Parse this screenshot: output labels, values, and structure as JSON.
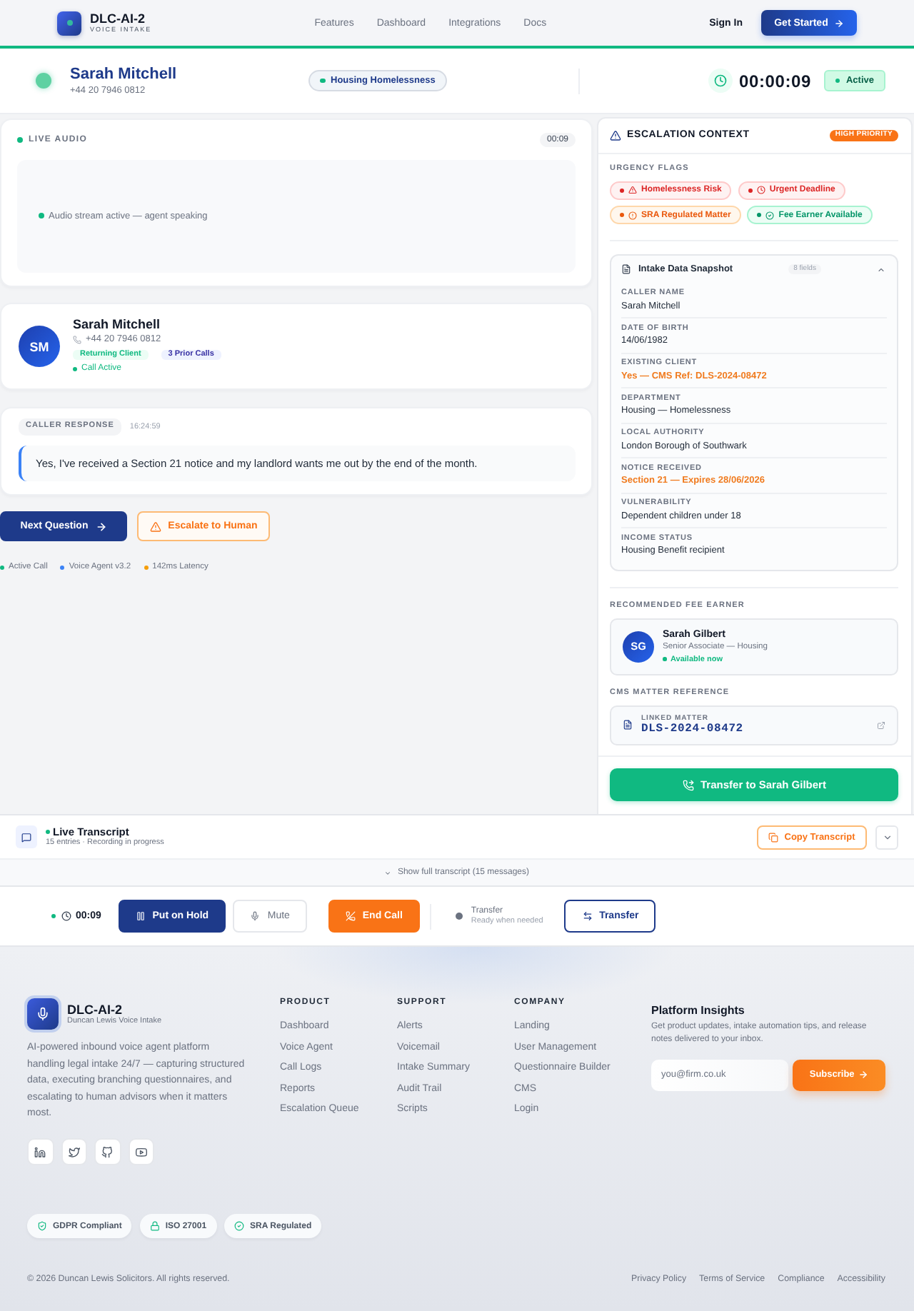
{
  "header": {
    "brand": {
      "name": "DLC-AI-2",
      "tagline": "VOICE INTAKE"
    },
    "nav": [
      "Features",
      "Dashboard",
      "Integrations",
      "Docs"
    ],
    "sign_in": "Sign In",
    "cta": "Get Started"
  },
  "caller_bar": {
    "name": "Sarah Mitchell",
    "phone": "+44 20 7946 0812",
    "category": "Housing Homelessness",
    "timer": "00:00:09",
    "status": "Active"
  },
  "live_audio": {
    "title": "LIVE AUDIO",
    "elapsed": "00:09",
    "stream_status": "Audio stream active — agent speaking"
  },
  "caller_card": {
    "initials": "SM",
    "name": "Sarah Mitchell",
    "phone": "+44 20 7946 0812",
    "badges": [
      {
        "label": "Returning Client",
        "kind": "success"
      },
      {
        "label": "3 Prior Calls",
        "kind": "info"
      }
    ],
    "status": "Call Active"
  },
  "caller_response": {
    "label": "CALLER RESPONSE",
    "time": "16:24:59",
    "text": "Yes, I've received a Section 21 notice and my landlord wants me out by the end of the month."
  },
  "actions": [
    {
      "label": "Next Question",
      "kind": "primary"
    },
    {
      "label": "Escalate to Human",
      "kind": "escalate"
    }
  ],
  "status_bar": [
    {
      "label": "Active Call",
      "color": "#10b981"
    },
    {
      "label": "Voice Agent v3.2",
      "color": "#3b82f6"
    },
    {
      "label": "142ms Latency",
      "color": "#f59e0b"
    }
  ],
  "escalation": {
    "title": "ESCALATION CONTEXT",
    "priority": "HIGH PRIORITY",
    "flags_title": "URGENCY FLAGS",
    "flags": [
      {
        "label": "Homelessness Risk",
        "kind": "risk"
      },
      {
        "label": "Urgent Deadline",
        "kind": "deadline"
      },
      {
        "label": "SRA Regulated Matter",
        "kind": "regulated"
      },
      {
        "label": "Fee Earner Available",
        "kind": "available"
      }
    ],
    "snapshot": {
      "title": "Intake Data Snapshot",
      "count": "8 fields",
      "expanded": true,
      "fields": [
        {
          "label": "CALLER NAME",
          "value": "Sarah Mitchell",
          "highlight": false
        },
        {
          "label": "DATE OF BIRTH",
          "value": "14/06/1982",
          "highlight": false
        },
        {
          "label": "EXISTING CLIENT",
          "value": "Yes — CMS Ref: DLS-2024-08472",
          "highlight": true
        },
        {
          "label": "DEPARTMENT",
          "value": "Housing — Homelessness",
          "highlight": false
        },
        {
          "label": "LOCAL AUTHORITY",
          "value": "London Borough of Southwark",
          "highlight": false
        },
        {
          "label": "NOTICE RECEIVED",
          "value": "Section 21 — Expires 28/06/2026",
          "highlight": true
        },
        {
          "label": "VULNERABILITY",
          "value": "Dependent children under 18",
          "highlight": false
        },
        {
          "label": "INCOME STATUS",
          "value": "Housing Benefit recipient",
          "highlight": false
        }
      ]
    },
    "fee_earner_title": "RECOMMENDED FEE EARNER",
    "fee_earner": {
      "initials": "SG",
      "name": "Sarah Gilbert",
      "role": "Senior Associate — Housing",
      "availability": "Available now"
    },
    "cms_title": "CMS MATTER REFERENCE",
    "cms": {
      "label": "LINKED MATTER",
      "reference": "DLS-2024-08472"
    },
    "transfer_button": "Transfer to Sarah Gilbert"
  },
  "transcript": {
    "title": "Live Transcript",
    "meta": "15 entries · Recording in progress",
    "copy_button": "Copy Transcript",
    "expanded": false,
    "toggle": "Show full transcript (15 messages)"
  },
  "call_controls": {
    "timer": "00:09",
    "buttons": [
      {
        "label": "Put on Hold",
        "kind": "hold"
      },
      {
        "label": "Mute",
        "kind": "mute"
      },
      {
        "label": "End Call",
        "kind": "end"
      }
    ],
    "transfer_status": {
      "title": "Transfer",
      "subtitle": "Ready when needed"
    },
    "transfer_button": "Transfer"
  },
  "footer": {
    "brand": {
      "name": "DLC-AI-2",
      "tagline": "Duncan Lewis Voice Intake"
    },
    "description": "AI-powered inbound voice agent platform handling legal intake 24/7 — capturing structured data, executing branching questionnaires, and escalating to human advisors when it matters most.",
    "columns": [
      {
        "title": "PRODUCT",
        "links": [
          "Dashboard",
          "Voice Agent",
          "Call Logs",
          "Reports",
          "Escalation Queue"
        ]
      },
      {
        "title": "SUPPORT",
        "links": [
          "Alerts",
          "Voicemail",
          "Intake Summary",
          "Audit Trail",
          "Scripts"
        ]
      },
      {
        "title": "COMPANY",
        "links": [
          "Landing",
          "User Management",
          "Questionnaire Builder",
          "CMS",
          "Login"
        ]
      }
    ],
    "newsletter": {
      "title": "Platform Insights",
      "text": "Get product updates, intake automation tips, and release notes delivered to your inbox.",
      "placeholder": "you@firm.co.uk",
      "button": "Subscribe"
    },
    "badges": [
      {
        "label": "GDPR Compliant",
        "kind": "shield"
      },
      {
        "label": "ISO 27001",
        "kind": "lock"
      },
      {
        "label": "SRA Regulated",
        "kind": "check"
      }
    ],
    "copyright": "© 2026 Duncan Lewis Solicitors. All rights reserved.",
    "legal_links": [
      "Privacy Policy",
      "Terms of Service",
      "Compliance",
      "Accessibility"
    ]
  }
}
